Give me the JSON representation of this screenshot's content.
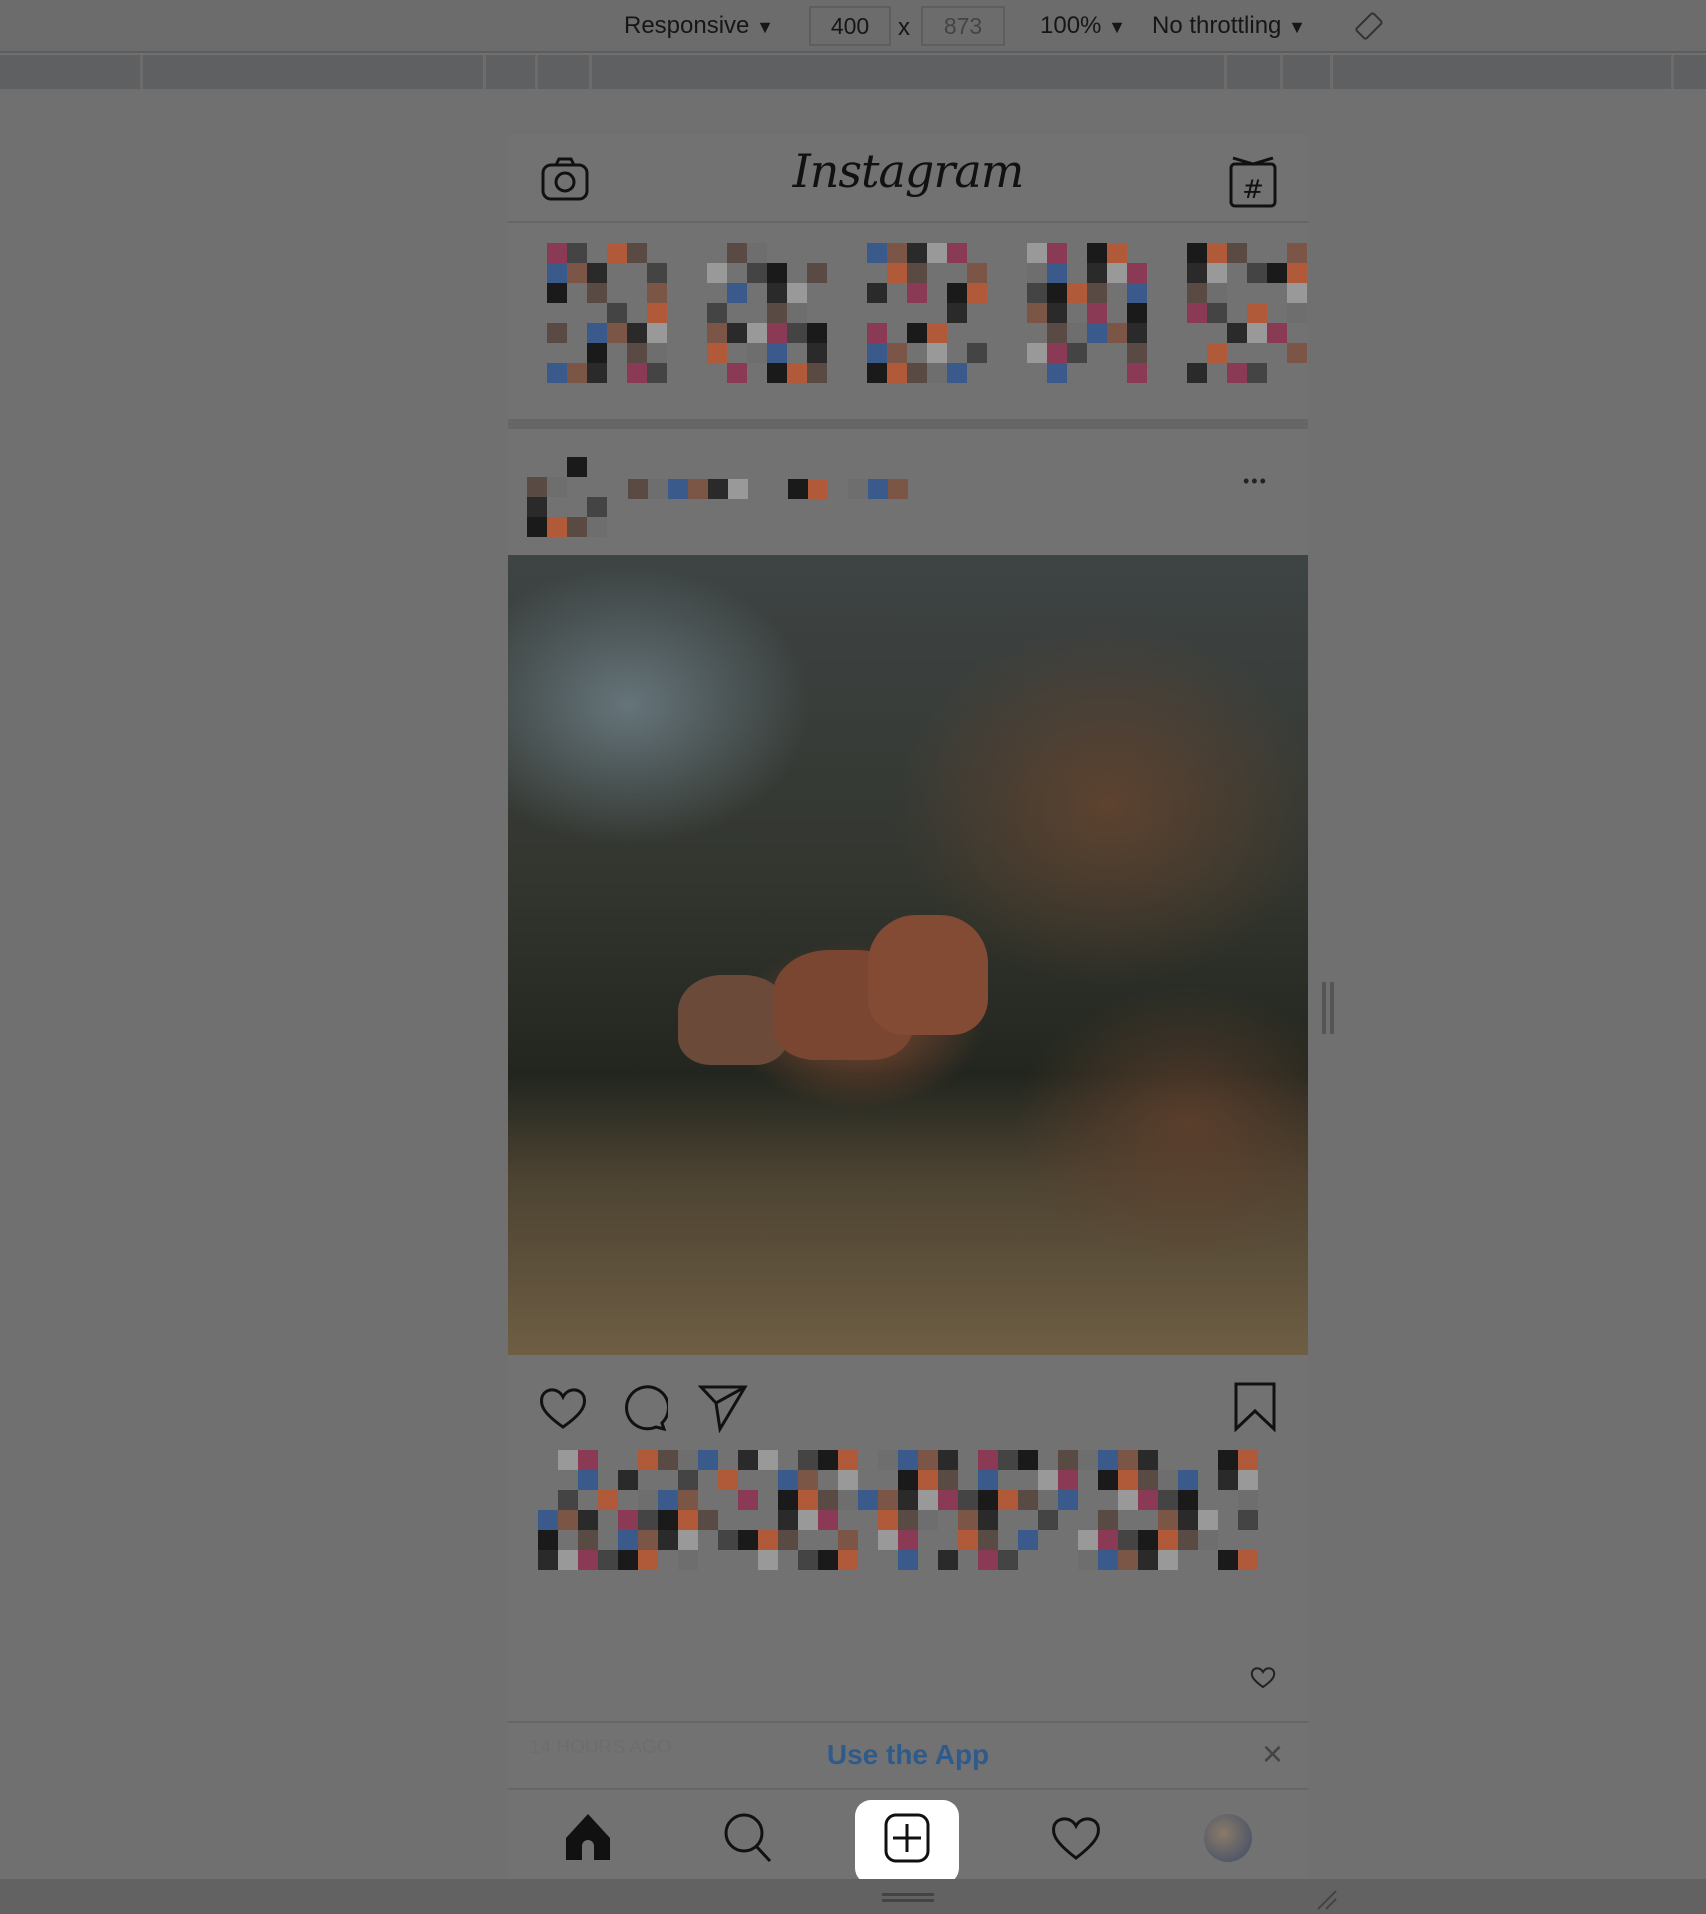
{
  "devtools": {
    "device": "Responsive",
    "width": "400",
    "times": "x",
    "height": "873",
    "zoom": "100%",
    "throttling": "No throttling",
    "dropdown_arrow": "▼",
    "rotate_icon": "rotate-icon"
  },
  "app": {
    "logo": "Instagram",
    "camera_icon": "camera-icon",
    "igtv_icon": "igtv-icon"
  },
  "post": {
    "more": "•••",
    "time": "14 HOURS AGO"
  },
  "banner": {
    "label": "Use the App",
    "close": "×"
  },
  "nav": {
    "items": [
      "home",
      "search",
      "new-post",
      "activity",
      "profile"
    ]
  },
  "colors": {
    "banner_text": "#2e5a8c",
    "overlay": "#707070"
  }
}
